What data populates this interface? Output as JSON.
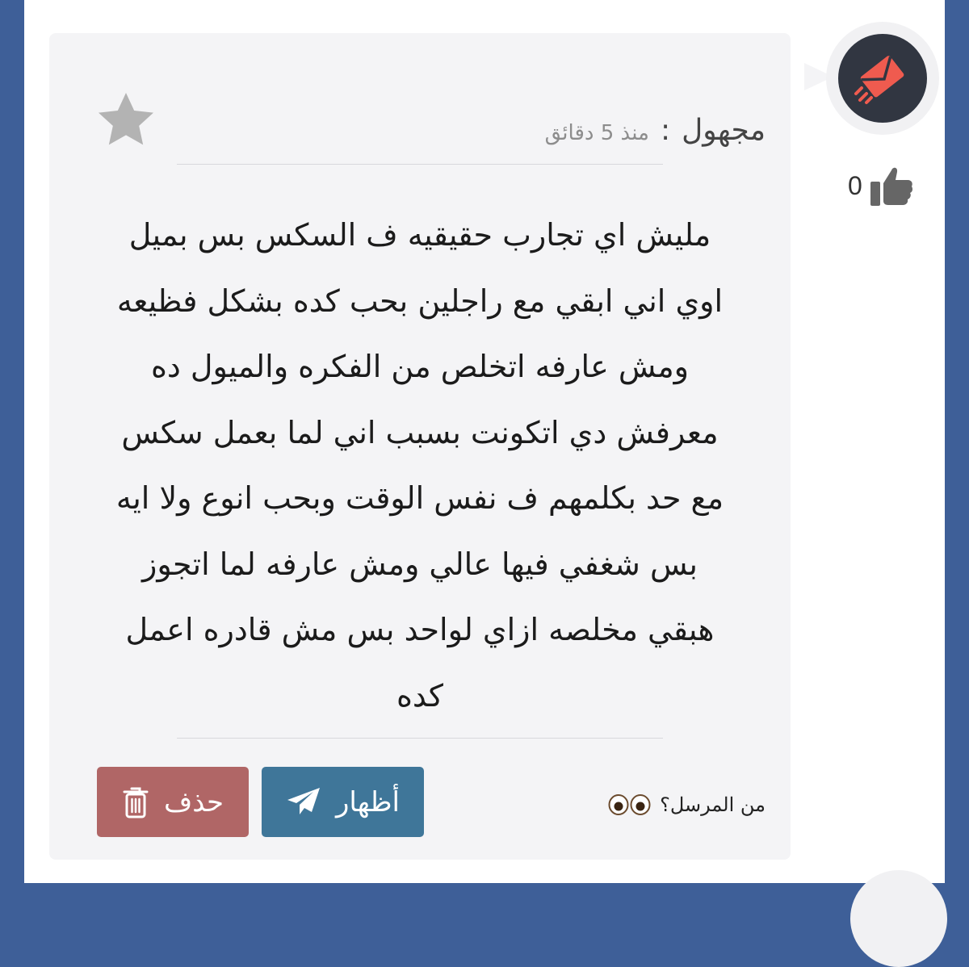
{
  "post": {
    "author": "مجهول",
    "separator": ":",
    "time": "منذ 5 دقائق",
    "message_lines": [
      "مليش اي تجارب حقيقيه ف السكس بس بميل",
      "اوي اني ابقي مع راجلين بحب كده بشكل فظيعه",
      "ومش عارفه اتخلص من الفكره والميول ده",
      "معرفش دي اتكونت بسبب اني لما بعمل سكس",
      "مع حد بكلمهم ف نفس الوقت وبحب انوع ولا ايه",
      "بس شغفي فيها عالي ومش عارفه لما اتجوز",
      "هبقي مخلصه ازاي لواحد بس مش قادره اعمل",
      "كده"
    ],
    "like_count": "0",
    "sender_question": "من المرسل؟",
    "reveal_label": "أظهار",
    "delete_label": "حذف"
  },
  "icons": {
    "avatar": "envelope-fast-icon",
    "like": "thumbs-up-icon",
    "favorite": "star-icon",
    "eyes": "eyes-emoji-icon",
    "reveal": "paper-plane-icon",
    "delete": "trash-icon"
  },
  "colors": {
    "page_bg": "#3e5f98",
    "card_bg": "#f4f4f6",
    "avatar_bg": "#313641",
    "avatar_accent": "#ef5b4f",
    "reveal_btn": "#3f7699",
    "delete_btn": "#b06666",
    "star": "#b3b3b3"
  }
}
